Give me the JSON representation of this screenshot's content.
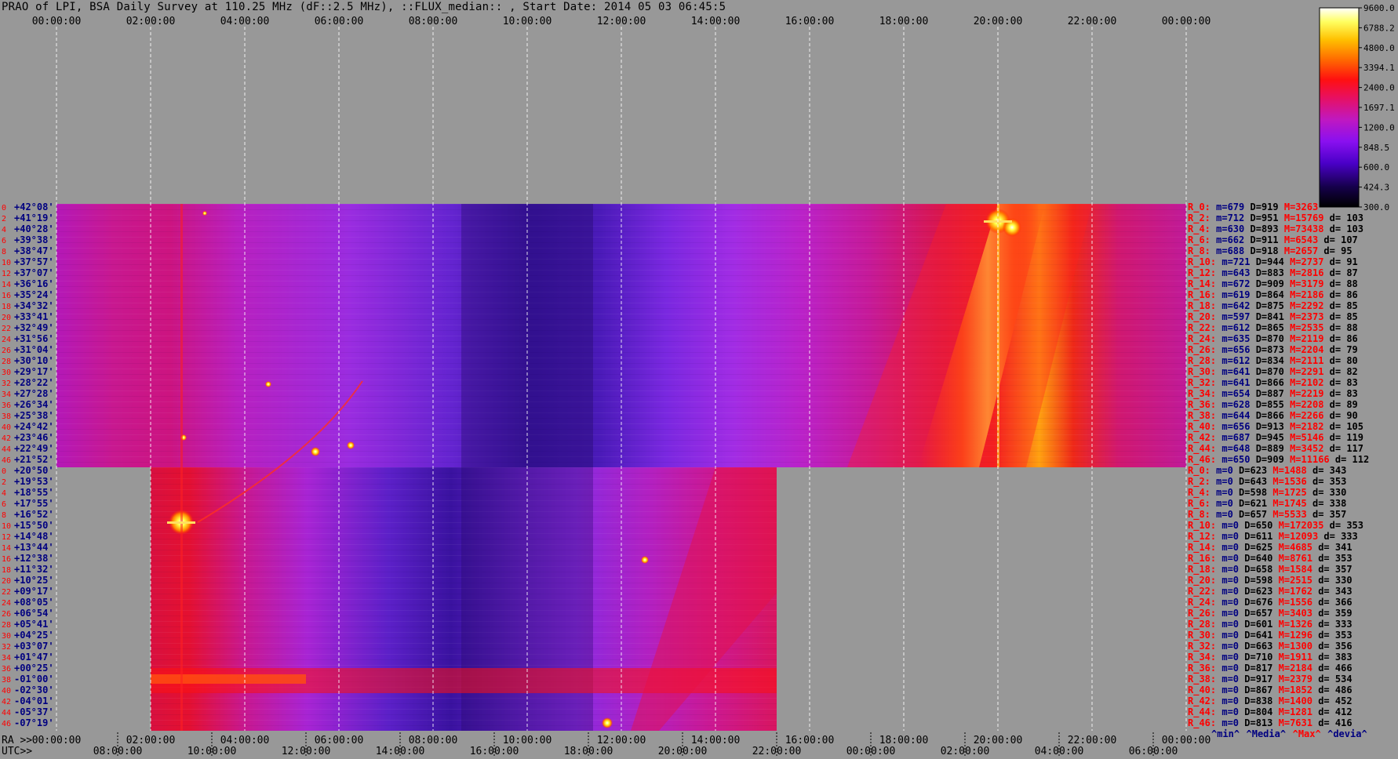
{
  "title": "PRAO of LPI, BSA Daily Survey at 110.25 MHz (dF::2.5 MHz), ::FLUX_median:: , Start Date: 2014 05 03 06:45:5",
  "axis_labels": {
    "ra": "RA >>",
    "utc": "UTC>>"
  },
  "colors": {
    "background": "#989898",
    "grid": "#ffffff",
    "dec_label": "#000080",
    "row_index": "#ff0000",
    "stat_blue": "#000080",
    "stat_red": "#ff0000"
  },
  "chart_data": {
    "type": "heatmap",
    "title": "PRAO of LPI, BSA Daily Survey at 110.25 MHz (dF::2.5 MHz), ::FLUX_median:: , Start Date: 2014 05 03 06:45:5",
    "top_time_ticks": [
      "00:00:00",
      "02:00:00",
      "04:00:00",
      "06:00:00",
      "08:00:00",
      "10:00:00",
      "12:00:00",
      "14:00:00",
      "16:00:00",
      "18:00:00",
      "20:00:00",
      "22:00:00",
      "00:00:00"
    ],
    "ra_time_ticks": [
      "00:00:00",
      "02:00:00",
      "04:00:00",
      "06:00:00",
      "08:00:00",
      "10:00:00",
      "12:00:00",
      "14:00:00",
      "16:00:00",
      "18:00:00",
      "20:00:00",
      "22:00:00",
      "00:00:00"
    ],
    "utc_time_ticks": [
      "08:00:00",
      "10:00:00",
      "12:00:00",
      "14:00:00",
      "16:00:00",
      "18:00:00",
      "20:00:00",
      "22:00:00",
      "00:00:00",
      "02:00:00",
      "04:00:00",
      "06:00:00"
    ],
    "colorbar": {
      "ticks": [
        "9600.0",
        "6788.2",
        "4800.0",
        "3394.1",
        "2400.0",
        "1697.1",
        "1200.0",
        "848.5",
        "600.0",
        "424.3",
        "300.0"
      ],
      "min": 300.0,
      "max": 9600.0,
      "scale": "log"
    },
    "upper_block": {
      "declinations": [
        "+42°08'",
        "+41°19'",
        "+40°28'",
        "+39°38'",
        "+38°47'",
        "+37°57'",
        "+37°07'",
        "+36°16'",
        "+35°24'",
        "+34°32'",
        "+33°41'",
        "+32°49'",
        "+31°56'",
        "+31°04'",
        "+30°10'",
        "+29°17'",
        "+28°22'",
        "+27°28'",
        "+26°34'",
        "+25°38'",
        "+24°42'",
        "+23°46'",
        "+22°49'",
        "+21°52'"
      ],
      "row_indices": [
        "0",
        "2",
        "4",
        "6",
        "8",
        "10",
        "12",
        "14",
        "16",
        "18",
        "20",
        "22",
        "24",
        "26",
        "28",
        "30",
        "32",
        "34",
        "36",
        "38",
        "40",
        "42",
        "44",
        "46"
      ],
      "stats": [
        {
          "name": "R_0:",
          "m": "m=679",
          "D": "D=919",
          "M": "M=3263",
          "d": ""
        },
        {
          "name": "R_2:",
          "m": "m=712",
          "D": "D=951",
          "M": "M=15769",
          "d": "d= 103"
        },
        {
          "name": "R_4:",
          "m": "m=630",
          "D": "D=893",
          "M": "M=73438",
          "d": "d= 103"
        },
        {
          "name": "R_6:",
          "m": "m=662",
          "D": "D=911",
          "M": "M=6543",
          "d": "d= 107"
        },
        {
          "name": "R_8:",
          "m": "m=688",
          "D": "D=918",
          "M": "M=2657",
          "d": "d= 95"
        },
        {
          "name": "R_10:",
          "m": "m=721",
          "D": "D=944",
          "M": "M=2737",
          "d": "d= 91"
        },
        {
          "name": "R_12:",
          "m": "m=643",
          "D": "D=883",
          "M": "M=2816",
          "d": "d= 87"
        },
        {
          "name": "R_14:",
          "m": "m=672",
          "D": "D=909",
          "M": "M=3179",
          "d": "d= 88"
        },
        {
          "name": "R_16:",
          "m": "m=619",
          "D": "D=864",
          "M": "M=2186",
          "d": "d= 86"
        },
        {
          "name": "R_18:",
          "m": "m=642",
          "D": "D=875",
          "M": "M=2292",
          "d": "d= 85"
        },
        {
          "name": "R_20:",
          "m": "m=597",
          "D": "D=841",
          "M": "M=2373",
          "d": "d= 85"
        },
        {
          "name": "R_22:",
          "m": "m=612",
          "D": "D=865",
          "M": "M=2535",
          "d": "d= 88"
        },
        {
          "name": "R_24:",
          "m": "m=635",
          "D": "D=870",
          "M": "M=2119",
          "d": "d= 86"
        },
        {
          "name": "R_26:",
          "m": "m=656",
          "D": "D=873",
          "M": "M=2204",
          "d": "d= 79"
        },
        {
          "name": "R_28:",
          "m": "m=612",
          "D": "D=834",
          "M": "M=2111",
          "d": "d= 80"
        },
        {
          "name": "R_30:",
          "m": "m=641",
          "D": "D=870",
          "M": "M=2291",
          "d": "d= 82"
        },
        {
          "name": "R_32:",
          "m": "m=641",
          "D": "D=866",
          "M": "M=2102",
          "d": "d= 83"
        },
        {
          "name": "R_34:",
          "m": "m=654",
          "D": "D=887",
          "M": "M=2219",
          "d": "d= 83"
        },
        {
          "name": "R_36:",
          "m": "m=628",
          "D": "D=855",
          "M": "M=2208",
          "d": "d= 89"
        },
        {
          "name": "R_38:",
          "m": "m=644",
          "D": "D=866",
          "M": "M=2266",
          "d": "d= 90"
        },
        {
          "name": "R_40:",
          "m": "m=656",
          "D": "D=913",
          "M": "M=2182",
          "d": "d= 105"
        },
        {
          "name": "R_42:",
          "m": "m=687",
          "D": "D=945",
          "M": "M=5146",
          "d": "d= 119"
        },
        {
          "name": "R_44:",
          "m": "m=648",
          "D": "D=889",
          "M": "M=3452",
          "d": "d= 117"
        },
        {
          "name": "R_46:",
          "m": "m=650",
          "D": "D=909",
          "M": "M=11166",
          "d": "d= 112"
        }
      ]
    },
    "lower_block": {
      "declinations": [
        "+20°50'",
        "+19°53'",
        "+18°55'",
        "+17°55'",
        "+16°52'",
        "+15°50'",
        "+14°48'",
        "+13°44'",
        "+12°38'",
        "+11°32'",
        "+10°25'",
        "+09°17'",
        "+08°05'",
        "+06°54'",
        "+05°41'",
        "+04°25'",
        "+03°07'",
        "+01°47'",
        "+00°25'",
        "-01°00'",
        "-02°30'",
        "-04°01'",
        "-05°37'",
        "-07°19'"
      ],
      "row_indices": [
        "0",
        "2",
        "4",
        "6",
        "8",
        "10",
        "12",
        "14",
        "16",
        "18",
        "20",
        "22",
        "24",
        "26",
        "28",
        "30",
        "32",
        "34",
        "36",
        "38",
        "40",
        "42",
        "44",
        "46"
      ],
      "stats": [
        {
          "name": "R_0:",
          "m": "m=0",
          "D": "D=623",
          "M": "M=1488",
          "d": "d= 343"
        },
        {
          "name": "R_2:",
          "m": "m=0",
          "D": "D=643",
          "M": "M=1536",
          "d": "d= 353"
        },
        {
          "name": "R_4:",
          "m": "m=0",
          "D": "D=598",
          "M": "M=1725",
          "d": "d= 330"
        },
        {
          "name": "R_6:",
          "m": "m=0",
          "D": "D=621",
          "M": "M=1745",
          "d": "d= 338"
        },
        {
          "name": "R_8:",
          "m": "m=0",
          "D": "D=657",
          "M": "M=5533",
          "d": "d= 357"
        },
        {
          "name": "R_10:",
          "m": "m=0",
          "D": "D=650",
          "M": "M=172035",
          "d": "d= 353"
        },
        {
          "name": "R_12:",
          "m": "m=0",
          "D": "D=611",
          "M": "M=12093",
          "d": "d= 333"
        },
        {
          "name": "R_14:",
          "m": "m=0",
          "D": "D=625",
          "M": "M=4685",
          "d": "d= 341"
        },
        {
          "name": "R_16:",
          "m": "m=0",
          "D": "D=640",
          "M": "M=8761",
          "d": "d= 353"
        },
        {
          "name": "R_18:",
          "m": "m=0",
          "D": "D=658",
          "M": "M=1584",
          "d": "d= 357"
        },
        {
          "name": "R_20:",
          "m": "m=0",
          "D": "D=598",
          "M": "M=2515",
          "d": "d= 330"
        },
        {
          "name": "R_22:",
          "m": "m=0",
          "D": "D=623",
          "M": "M=1762",
          "d": "d= 343"
        },
        {
          "name": "R_24:",
          "m": "m=0",
          "D": "D=676",
          "M": "M=1556",
          "d": "d= 366"
        },
        {
          "name": "R_26:",
          "m": "m=0",
          "D": "D=657",
          "M": "M=3403",
          "d": "d= 359"
        },
        {
          "name": "R_28:",
          "m": "m=0",
          "D": "D=601",
          "M": "M=1326",
          "d": "d= 333"
        },
        {
          "name": "R_30:",
          "m": "m=0",
          "D": "D=641",
          "M": "M=1296",
          "d": "d= 353"
        },
        {
          "name": "R_32:",
          "m": "m=0",
          "D": "D=663",
          "M": "M=1300",
          "d": "d= 356"
        },
        {
          "name": "R_34:",
          "m": "m=0",
          "D": "D=710",
          "M": "M=1911",
          "d": "d= 383"
        },
        {
          "name": "R_36:",
          "m": "m=0",
          "D": "D=817",
          "M": "M=2184",
          "d": "d= 466"
        },
        {
          "name": "R_38:",
          "m": "m=0",
          "D": "D=917",
          "M": "M=2379",
          "d": "d= 534"
        },
        {
          "name": "R_40:",
          "m": "m=0",
          "D": "D=867",
          "M": "M=1852",
          "d": "d= 486"
        },
        {
          "name": "R_42:",
          "m": "m=0",
          "D": "D=838",
          "M": "M=1400",
          "d": "d= 452"
        },
        {
          "name": "R_44:",
          "m": "m=0",
          "D": "D=804",
          "M": "M=1281",
          "d": "d= 412"
        },
        {
          "name": "R_46:",
          "m": "m=0",
          "D": "D=813",
          "M": "M=7631",
          "d": "d= 416"
        }
      ]
    },
    "stats_legend": [
      {
        "text": "^min^",
        "color": "#000080"
      },
      {
        "text": "^Media^",
        "color": "#000080"
      },
      {
        "text": "^Max^",
        "color": "#ff0000"
      },
      {
        "text": "^devia^",
        "color": "#000080"
      }
    ]
  }
}
